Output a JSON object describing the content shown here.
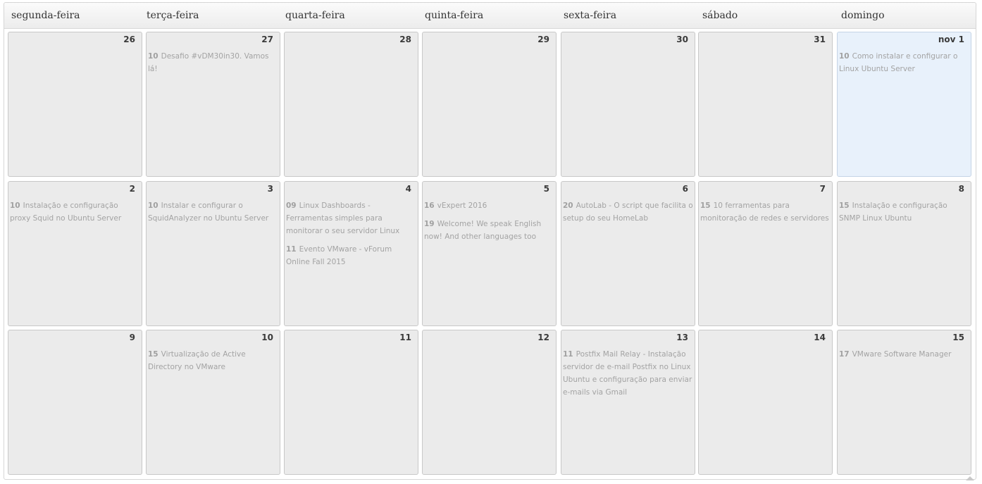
{
  "weekdays": [
    "segunda-feira",
    "terça-feira",
    "quarta-feira",
    "quinta-feira",
    "sexta-feira",
    "sábado",
    "domingo"
  ],
  "weeks": [
    [
      {
        "day": "26",
        "events": []
      },
      {
        "day": "27",
        "events": [
          {
            "time": "10",
            "title": "Desafio #vDM30in30. Vamos lá!"
          }
        ]
      },
      {
        "day": "28",
        "events": []
      },
      {
        "day": "29",
        "events": []
      },
      {
        "day": "30",
        "events": []
      },
      {
        "day": "31",
        "events": []
      },
      {
        "day": "nov 1",
        "today": true,
        "events": [
          {
            "time": "10",
            "title": "Como instalar e configurar o Linux Ubuntu Server"
          }
        ]
      }
    ],
    [
      {
        "day": "2",
        "events": [
          {
            "time": "10",
            "title": "Instalação e configuração proxy Squid no Ubuntu Server"
          }
        ]
      },
      {
        "day": "3",
        "events": [
          {
            "time": "10",
            "title": "Instalar e configurar o SquidAnalyzer no Ubuntu Server"
          }
        ]
      },
      {
        "day": "4",
        "events": [
          {
            "time": "09",
            "title": "Linux Dashboards - Ferramentas simples para monitorar o seu servidor Linux"
          },
          {
            "time": "11",
            "title": "Evento VMware - vForum Online Fall 2015"
          }
        ]
      },
      {
        "day": "5",
        "events": [
          {
            "time": "16",
            "title": "vExpert 2016"
          },
          {
            "time": "19",
            "title": "Welcome! We speak English now! And other languages too"
          }
        ]
      },
      {
        "day": "6",
        "events": [
          {
            "time": "20",
            "title": "AutoLab - O script que facilita o setup do seu HomeLab"
          }
        ]
      },
      {
        "day": "7",
        "events": [
          {
            "time": "15",
            "title": "10 ferramentas para monitoração de redes e servidores"
          }
        ]
      },
      {
        "day": "8",
        "events": [
          {
            "time": "15",
            "title": "Instalação e configuração SNMP Linux Ubuntu"
          }
        ]
      }
    ],
    [
      {
        "day": "9",
        "events": []
      },
      {
        "day": "10",
        "events": [
          {
            "time": "15",
            "title": "Virtualização de Active Directory no VMware"
          }
        ]
      },
      {
        "day": "11",
        "events": []
      },
      {
        "day": "12",
        "events": []
      },
      {
        "day": "13",
        "events": [
          {
            "time": "11",
            "title": "Postfix Mail Relay - Instalação servidor de e-mail Postfix no Linux Ubuntu e configuração para enviar e-mails via Gmail"
          }
        ]
      },
      {
        "day": "14",
        "events": []
      },
      {
        "day": "15",
        "events": [
          {
            "time": "17",
            "title": "VMware Software Manager"
          }
        ]
      }
    ]
  ],
  "colors": {
    "cell": "#ebebeb",
    "today": "#e8f1fb",
    "event_text": "#a3a3a3"
  },
  "icons": {
    "scroll": "scroll-up-arrow-icon"
  }
}
